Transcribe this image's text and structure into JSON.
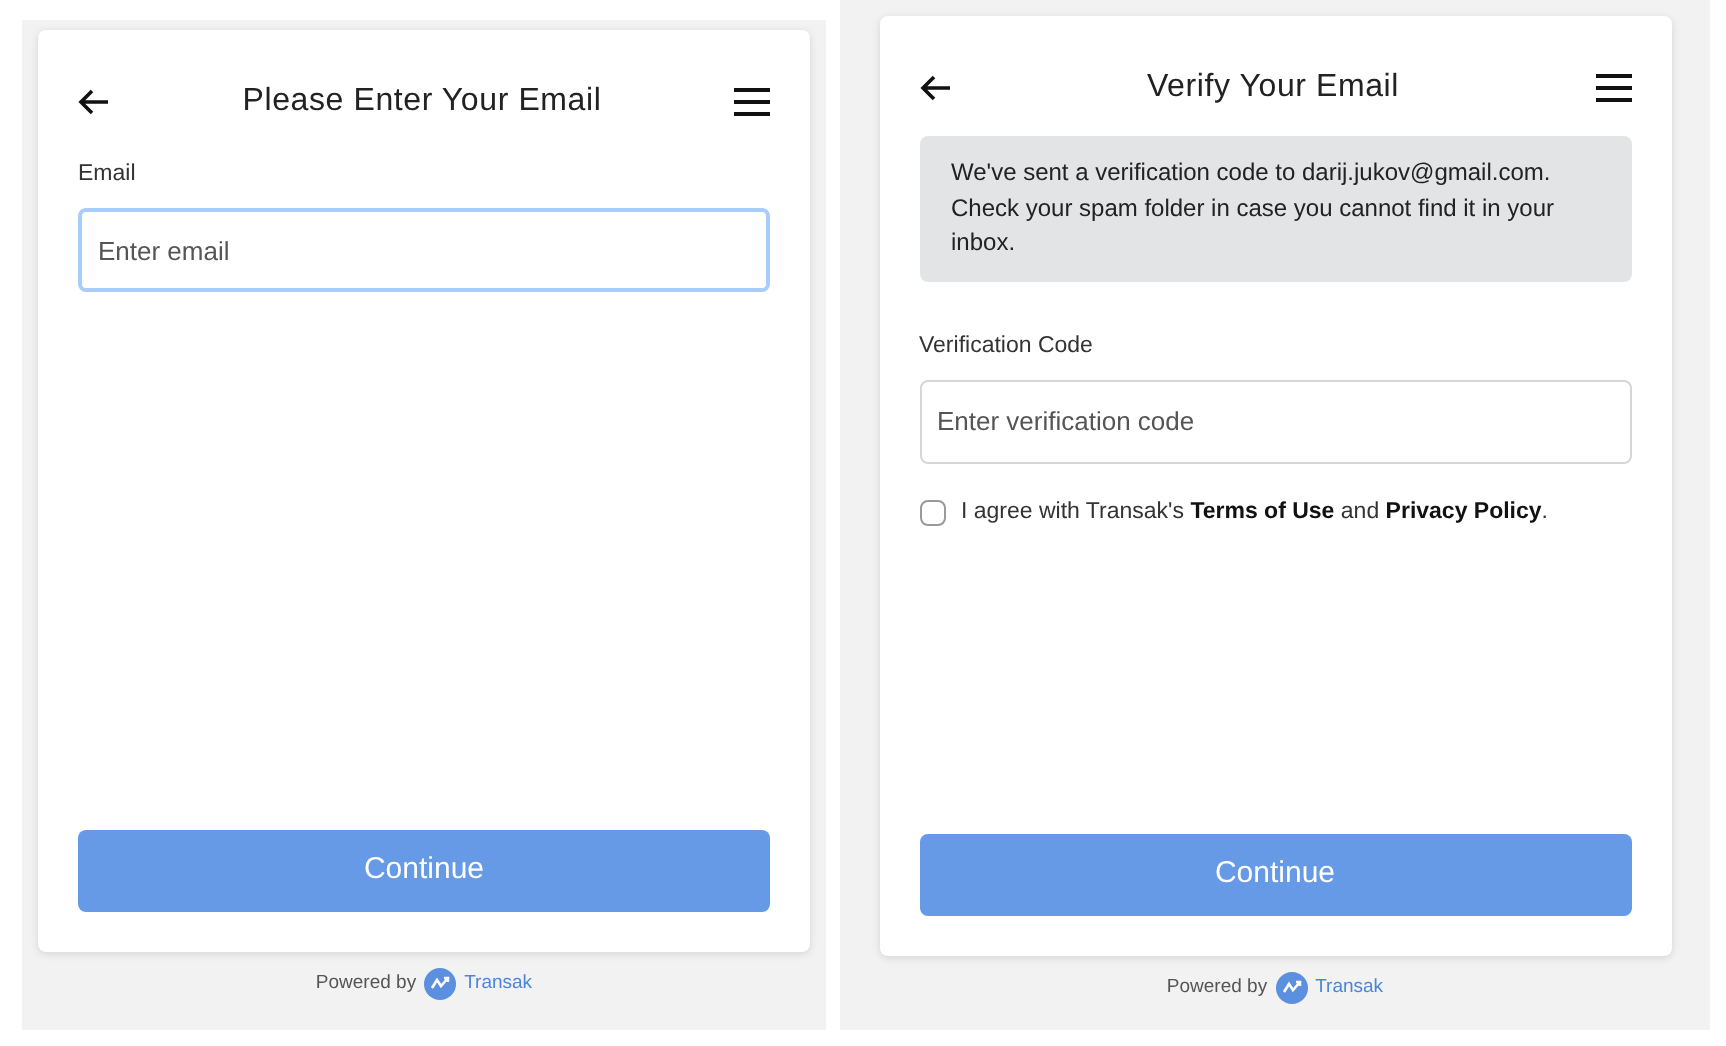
{
  "screens": [
    {
      "title": "Please Enter Your Email",
      "fields": [
        {
          "label": "Email",
          "placeholder": "Enter email",
          "focused": true
        }
      ],
      "button": "Continue",
      "powered_by": "Powered by",
      "brand": "Transak"
    },
    {
      "title": "Verify Your Email",
      "notice": "We've sent a verification code to darij.jukov@gmail.com. Check your spam folder in case you cannot find it in your inbox.",
      "fields": [
        {
          "label": "Verification Code",
          "placeholder": "Enter verification code",
          "focused": false
        }
      ],
      "agreement": {
        "text": "I agree with Transak's **Terms of Use** and **Privacy Policy**.",
        "checked": false
      },
      "button": "Continue",
      "powered_by": "Powered by",
      "brand": "Transak"
    }
  ]
}
